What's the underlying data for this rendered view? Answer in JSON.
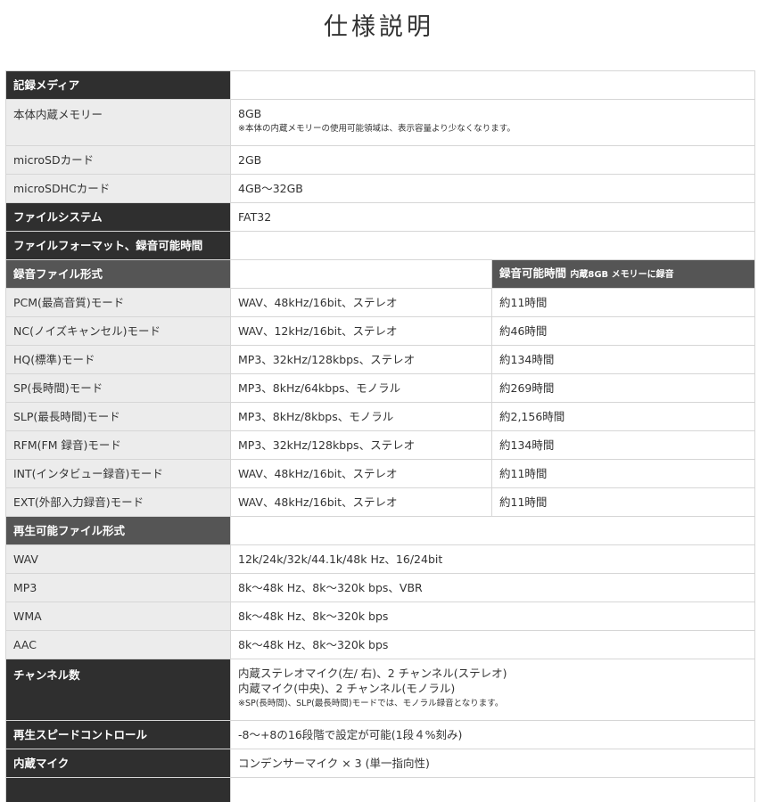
{
  "title": "仕様説明",
  "media": {
    "header": "記録メディア",
    "internal_label": "本体内蔵メモリー",
    "internal_value": "8GB",
    "internal_note": "※本体の内蔵メモリーの使用可能領域は、表示容量より少なくなります。",
    "microsd_label": "microSDカード",
    "microsd_value": "2GB",
    "microsdhc_label": "microSDHCカード",
    "microsdhc_value": "4GB～32GB"
  },
  "filesystem": {
    "label": "ファイルシステム",
    "value": "FAT32"
  },
  "format_section": {
    "header": "ファイルフォーマット、録音可能時間",
    "rec_format_header": "録音ファイル形式",
    "rec_time_header": "録音可能時間",
    "rec_time_note": "内蔵8GB メモリーに録音"
  },
  "rec_modes": [
    {
      "mode": "PCM(最高音質)モード",
      "format": "WAV、48kHz/16bit、ステレオ",
      "time": "約11時間"
    },
    {
      "mode": "NC(ノイズキャンセル)モード",
      "format": "WAV、12kHz/16bit、ステレオ",
      "time": "約46時間"
    },
    {
      "mode": "HQ(標準)モード",
      "format": "MP3、32kHz/128kbps、ステレオ",
      "time": "約134時間"
    },
    {
      "mode": "SP(長時間)モード",
      "format": "MP3、8kHz/64kbps、モノラル",
      "time": "約269時間"
    },
    {
      "mode": "SLP(最長時間)モード",
      "format": "MP3、8kHz/8kbps、モノラル",
      "time": "約2,156時間"
    },
    {
      "mode": "RFM(FM 録音)モード",
      "format": "MP3、32kHz/128kbps、ステレオ",
      "time": "約134時間"
    },
    {
      "mode": "INT(インタビュー録音)モード",
      "format": "WAV、48kHz/16bit、ステレオ",
      "time": "約11時間"
    },
    {
      "mode": "EXT(外部入力録音)モード",
      "format": "WAV、48kHz/16bit、ステレオ",
      "time": "約11時間"
    }
  ],
  "playback": {
    "header": "再生可能ファイル形式",
    "rows": [
      {
        "label": "WAV",
        "value": "12k/24k/32k/44.1k/48k Hz、16/24bit"
      },
      {
        "label": "MP3",
        "value": "8k～48k Hz、8k～320k bps、VBR"
      },
      {
        "label": "WMA",
        "value": "8k～48k Hz、8k～320k bps"
      },
      {
        "label": "AAC",
        "value": "8k～48k Hz、8k～320k bps"
      }
    ]
  },
  "channels": {
    "label": "チャンネル数",
    "line1": "内蔵ステレオマイク(左/ 右)、2 チャンネル(ステレオ)",
    "line2": "内蔵マイク(中央)、2 チャンネル(モノラル)",
    "note": "※SP(長時間)、SLP(最長時間)モードでは、モノラル録音となります。"
  },
  "speed": {
    "label": "再生スピードコントロール",
    "value": "-8～+8の16段階で設定が可能(1段４%刻み)"
  },
  "mic": {
    "label": "内蔵マイク",
    "value": "コンデンサーマイク × 3 (単一指向性)"
  }
}
